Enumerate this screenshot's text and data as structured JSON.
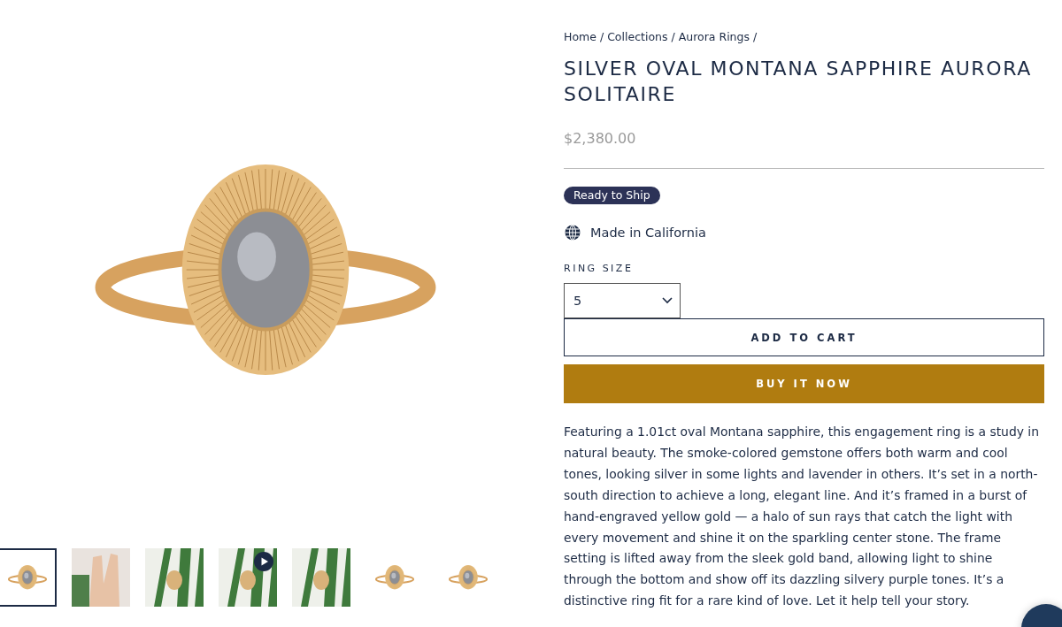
{
  "breadcrumbs": [
    {
      "label": "Home",
      "separator": "/"
    },
    {
      "label": "Collections",
      "separator": "/"
    },
    {
      "label": "Aurora Rings",
      "separator": "/"
    }
  ],
  "product": {
    "title": "SILVER OVAL MONTANA SAPPHIRE AURORA SOLITAIRE",
    "price": "$2,380.00",
    "badge": "Ready to Ship",
    "origin": "Made in California"
  },
  "ring_size": {
    "label": "RING SIZE",
    "value": "5"
  },
  "buttons": {
    "add_to_cart": "ADD TO CART",
    "buy_now": "BUY IT NOW"
  },
  "description": "Featuring a 1.01ct oval Montana sapphire, this engagement ring is a study in natural beauty. The smoke-colored gemstone offers both warm and cool tones, looking silver in some lights and lavender in others. It’s set in a north-south direction to achieve a long, elegant line. And it’s framed in a burst of hand-engraved yellow gold — a halo of sun rays that catch the light with every movement and shine it on the sparkling center stone. The frame setting is lifted away from the sleek gold band, allowing light to shine through the bottom and show off its dazzling silvery purple tones. It’s a distinctive ring fit for a rare kind of love. Let it help tell your story.",
  "thumbnails": [
    {
      "kind": "studio",
      "selected": true
    },
    {
      "kind": "hand",
      "selected": false
    },
    {
      "kind": "plant",
      "selected": false
    },
    {
      "kind": "video",
      "selected": false
    },
    {
      "kind": "plant",
      "selected": false
    },
    {
      "kind": "studio",
      "selected": false
    },
    {
      "kind": "studio",
      "selected": false
    }
  ]
}
